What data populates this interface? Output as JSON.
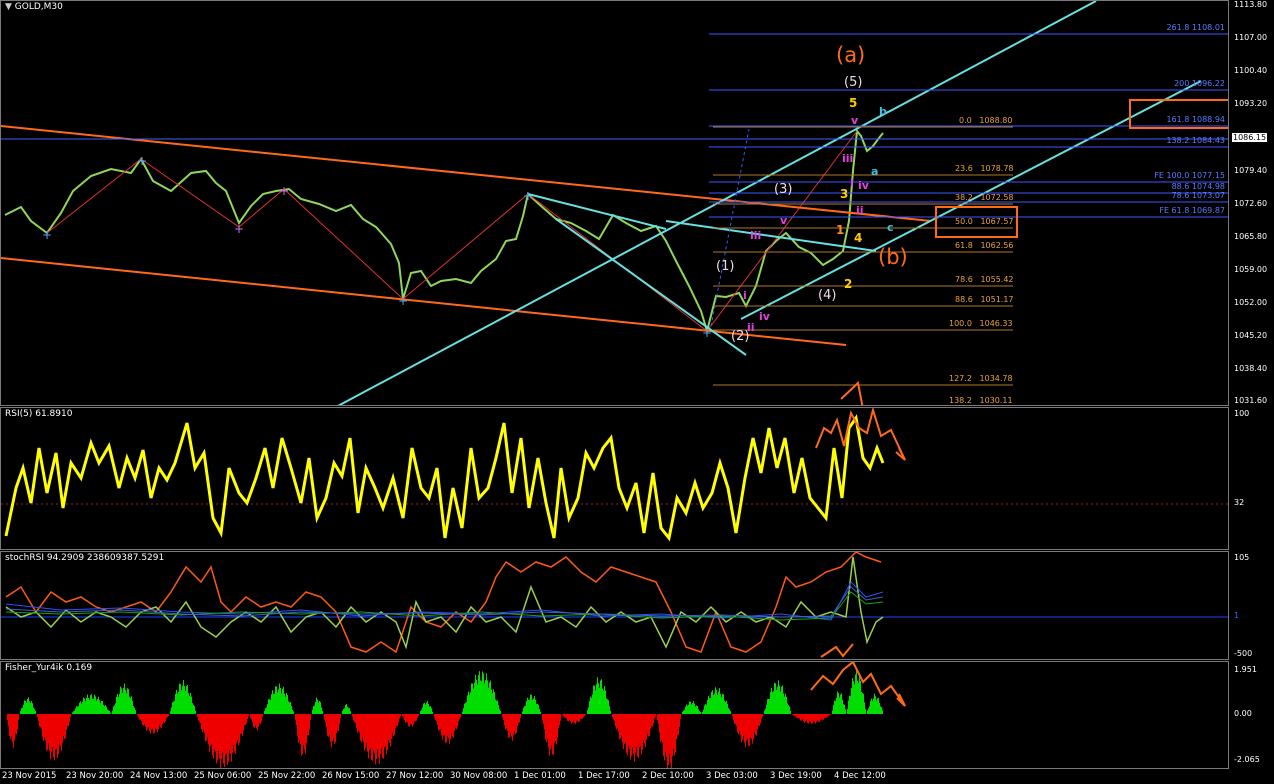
{
  "main": {
    "title": "GOLD,M30",
    "y_labels": [
      "1113.80",
      "1107.00",
      "1100.40",
      "1093.20",
      "1086.15",
      "1079.40",
      "1072.60",
      "1065.80",
      "1059.00",
      "1052.00",
      "1045.20",
      "1038.40",
      "1031.60"
    ],
    "current_price": "1086.15",
    "fib_labels": [
      "261.8  1108.01",
      "200  1096.22",
      "161.8  1088.94",
      "138.2  1084.43",
      "FE 100.0  1077.15",
      "88.6  1074.98",
      "78.6  1073.07",
      "FE 61.8  1069.87"
    ],
    "retr_labels": [
      "0.0   1088.80",
      "23.6   1078.78",
      "38.2   1072.58",
      "50.0   1067.57",
      "61.8   1062.56",
      "78.6   1055.42",
      "88.6   1051.17",
      "100.0   1046.33",
      "127.2   1034.78",
      "138.2   1030.11"
    ],
    "wave_labels": {
      "a_paren": "(a)",
      "b_paren": "(b)",
      "w5_paren": "(5)",
      "w4_paren": "(4)",
      "w3_paren": "(3)",
      "w2_paren": "(2)",
      "w1_paren": "(1)",
      "n5": "5",
      "n4": "4",
      "n3": "3",
      "n2": "2",
      "n1": "1",
      "v": "v",
      "v2": "v",
      "iv": "iv",
      "iv2": "iv",
      "iii": "iii",
      "iii2": "iii",
      "ii": "ii",
      "ii2": "ii",
      "i": "i",
      "i2": "i",
      "a": "a",
      "b": "b",
      "c": "c"
    }
  },
  "rsi": {
    "title": "RSI(5) 61.8910",
    "y_labels": [
      "100",
      "32"
    ]
  },
  "stoch": {
    "title": "stochRSI 94.2909 238609387.5291",
    "y_labels": [
      "105",
      "1",
      "-500"
    ]
  },
  "fisher": {
    "title": "Fisher_Yur4ik 0.169",
    "y_labels": [
      "1.951",
      "0.00",
      "-2.065"
    ]
  },
  "x_axis": [
    "23 Nov 2015",
    "23 Nov 20:00",
    "24 Nov 13:00",
    "25 Nov 06:00",
    "25 Nov 22:00",
    "26 Nov 15:00",
    "27 Nov 12:00",
    "30 Nov 08:00",
    "1 Dec 01:00",
    "1 Dec 17:00",
    "2 Dec 10:00",
    "3 Dec 03:00",
    "3 Dec 19:00",
    "4 Dec 12:00"
  ],
  "colors": {
    "bull": "#00c000",
    "candle": "#8fd65b",
    "orange": "#ff6a1a",
    "cyan": "#66e0e0",
    "fib_blue": "#3a57ff",
    "fib_orange": "#e8a23c",
    "rsi": "#ffff00",
    "fisher_up": "#00dd00",
    "fisher_dn": "#ee0000"
  }
}
